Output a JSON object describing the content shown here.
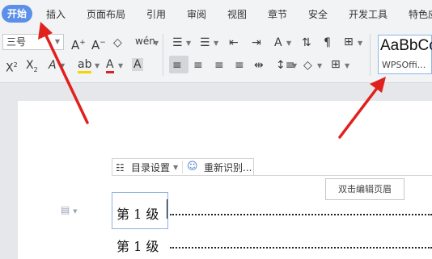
{
  "menu": {
    "items": [
      "开始",
      "插入",
      "页面布局",
      "引用",
      "审阅",
      "视图",
      "章节",
      "安全",
      "开发工具",
      "特色应"
    ]
  },
  "ribbon": {
    "font_size_value": "三号",
    "style_sample": "AaBbCc",
    "style_name": "WPSOffi..."
  },
  "document": {
    "toc_settings_label": "目录设置",
    "re_recognize_label": "重新识别...",
    "edit_header_label": "双击编辑页眉",
    "toc_entries": [
      "第 1 级",
      "第 1 级"
    ]
  },
  "colors": {
    "accent": "#5b8fe9",
    "arrow": "#e0211d"
  },
  "icons": [
    "font-grow-icon",
    "font-shrink-icon",
    "clear-format-icon",
    "phonetic-icon",
    "superscript-icon",
    "subscript-icon",
    "text-effect-icon",
    "highlight-icon",
    "font-color-icon",
    "char-shading-icon",
    "bullets-icon",
    "numbering-icon",
    "decrease-indent-icon",
    "increase-indent-icon",
    "sort-icon",
    "show-marks-icon",
    "table-icon",
    "align-left-icon",
    "align-center-icon",
    "align-right-icon",
    "justify-icon",
    "distributed-icon",
    "line-spacing-icon",
    "shading-icon",
    "borders-icon",
    "toc-settings-icon",
    "re-recognize-icon",
    "page-icon"
  ]
}
